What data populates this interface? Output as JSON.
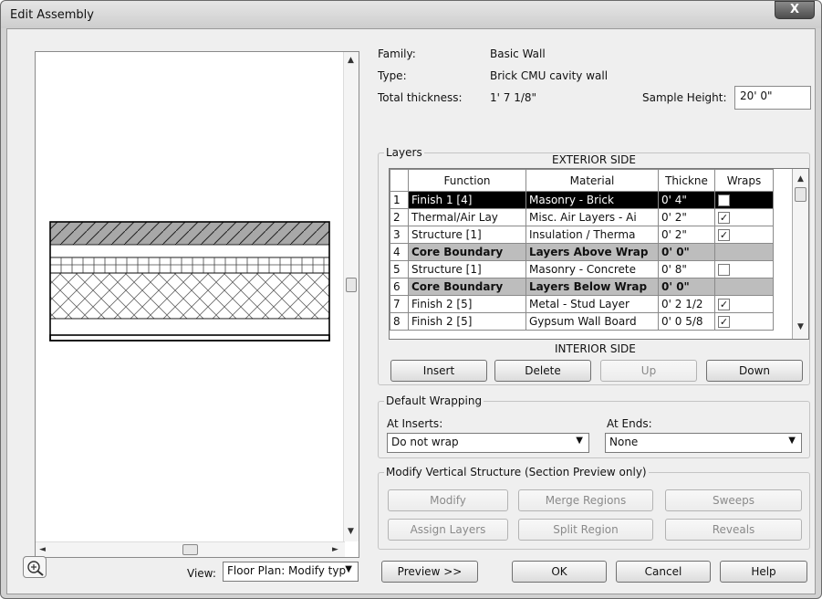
{
  "window": {
    "title": "Edit Assembly",
    "close_label": "X"
  },
  "properties": {
    "family_label": "Family:",
    "family_value": "Basic Wall",
    "type_label": "Type:",
    "type_value": "Brick  CMU cavity wall",
    "thickness_label": "Total thickness:",
    "thickness_value": "1'  7 1/8\"",
    "sample_height_label": "Sample Height:",
    "sample_height_value": "20'  0\""
  },
  "layers": {
    "legend": "Layers",
    "exterior_label": "EXTERIOR SIDE",
    "interior_label": "INTERIOR SIDE",
    "columns": [
      "Function",
      "Material",
      "Thickne",
      "Wraps"
    ],
    "rows": [
      {
        "num": "1",
        "function": "Finish 1 [4]",
        "material": "Masonry - Brick",
        "thickness": "0'  4\"",
        "wraps": "✓"
      },
      {
        "num": "2",
        "function": "Thermal/Air Lay",
        "material": "Misc. Air Layers - Ai",
        "thickness": "0'  2\"",
        "wraps": "✓"
      },
      {
        "num": "3",
        "function": "Structure [1]",
        "material": "Insulation / Therma",
        "thickness": "0'  2\"",
        "wraps": "✓"
      },
      {
        "num": "4",
        "function": "Core Boundary",
        "material": "Layers Above Wrap",
        "thickness": "0'  0\"",
        "wraps": ""
      },
      {
        "num": "5",
        "function": "Structure [1]",
        "material": "Masonry - Concrete",
        "thickness": "0'  8\"",
        "wraps": " "
      },
      {
        "num": "6",
        "function": "Core Boundary",
        "material": "Layers Below Wrap",
        "thickness": "0'  0\"",
        "wraps": ""
      },
      {
        "num": "7",
        "function": "Finish 2 [5]",
        "material": "Metal - Stud Layer",
        "thickness": "0'  2 1/2",
        "wraps": "✓"
      },
      {
        "num": "8",
        "function": "Finish 2 [5]",
        "material": "Gypsum Wall Board",
        "thickness": "0'  0 5/8",
        "wraps": "✓"
      }
    ],
    "buttons": {
      "insert": "Insert",
      "delete": "Delete",
      "up": "Up",
      "down": "Down"
    }
  },
  "wrapping": {
    "legend": "Default Wrapping",
    "inserts_label": "At Inserts:",
    "inserts_value": "Do not wrap",
    "ends_label": "At Ends:",
    "ends_value": "None"
  },
  "vertical": {
    "legend": "Modify Vertical Structure (Section Preview only)",
    "buttons": {
      "modify": "Modify",
      "merge": "Merge Regions",
      "sweeps": "Sweeps",
      "assign": "Assign Layers",
      "split": "Split Region",
      "reveals": "Reveals"
    }
  },
  "footer": {
    "view_label": "View:",
    "view_value": "Floor Plan: Modify typ",
    "preview": "Preview >>",
    "ok": "OK",
    "cancel": "Cancel",
    "help": "Help"
  },
  "icons": {
    "zoom": "zoom-icon"
  }
}
